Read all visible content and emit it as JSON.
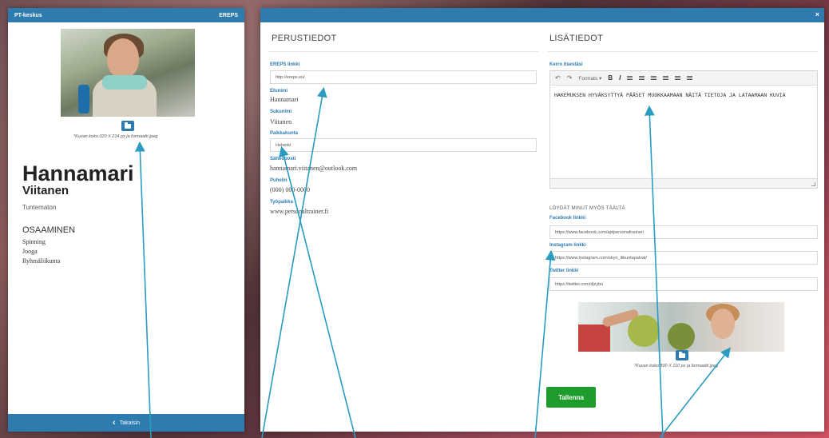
{
  "left_card": {
    "header_left": "PT-keskus",
    "header_right": "EREPS",
    "photo_note": "*Kuvan koko 320 X 214 px ja formaatti jpeg",
    "first_name": "Hannamari",
    "last_name": "Viitanen",
    "status": "Tuntematon",
    "skills_heading": "OSAAMINEN",
    "skills": [
      "Spinning",
      "Jooga",
      "Ryhmäliikunta"
    ],
    "back_label": "Takaisin"
  },
  "basic": {
    "title": "PERUSTIEDOT",
    "ereps_label": "EREPS linkki",
    "ereps_value": "http://ereps.eu/",
    "firstname_label": "Etunimi",
    "firstname_value": "Hannamari",
    "lastname_label": "Sukunimi",
    "lastname_value": "Viitanen",
    "city_label": "Paikkakunta",
    "city_value": "Helsinki",
    "email_label": "Sähköposti",
    "email_value": "hannamari.viitanen@outlook.com",
    "phone_label": "Puhelin",
    "phone_value": "(000) 000-0000",
    "workplace_label": "Työpaikka",
    "workplace_value": "www.personaltrainer.fi"
  },
  "extra": {
    "title": "LISÄTIEDOT",
    "about_label": "Kerro itsestäsi",
    "toolbar_formats": "Formats ▾",
    "toolbar_bold": "B",
    "toolbar_italic": "I",
    "editor_text": "HAKEMUKSEN HYVÄKSYTTYÄ PÄÄSET MUOKKAAMAAN NÄITÄ TIETOJA JA LATAAMAAN KUVIA",
    "find_me_heading": "LÖYDÄT MINUT MYÖS TÄÄLTÄ",
    "facebook_label": "Facebook linkki",
    "facebook_value": "https://www.facebook.com/aptpersonaltrainer/",
    "instagram_label": "Instagram linkki",
    "instagram_value": "https://www.instagram.com/skyn_liikuntapalvat/",
    "twitter_label": "Twitter linkki",
    "twitter_value": "https://twitter.com/djzybo",
    "banner_note": "*Kuvan koko 800 X 110 px ja formaatti jpeg",
    "save_label": "Tallenna"
  },
  "icons": {
    "close": "×",
    "back": "‹",
    "undo": "↶",
    "redo": "↷"
  },
  "colors": {
    "accent": "#2e7bb0",
    "save": "#1e9d2c",
    "annotation": "#2a9bc1"
  }
}
